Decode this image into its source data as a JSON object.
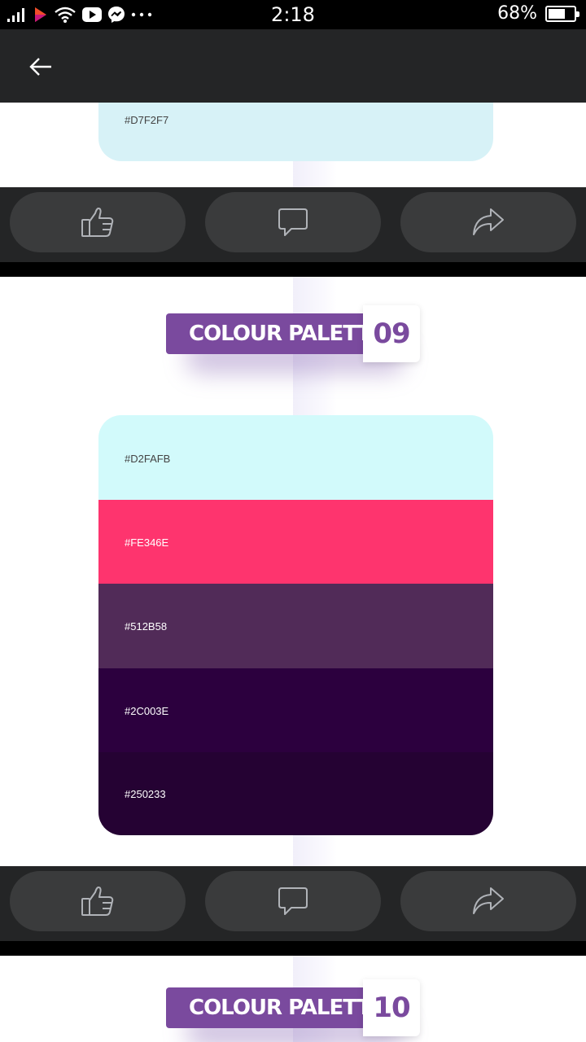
{
  "status_bar": {
    "time": "2:18",
    "battery_percent_text": "68%",
    "battery_level": 0.68,
    "icons": [
      "signal-icon",
      "app-notification-icon",
      "wifi-icon",
      "youtube-icon",
      "messenger-icon",
      "more-dots-icon"
    ]
  },
  "app_bar": {
    "back_icon": "arrow-left-icon"
  },
  "posts": [
    {
      "swatches": [
        {
          "code": "#D7F2F7",
          "color": "#D7F2F7",
          "text_color": "#444444"
        }
      ]
    },
    {
      "badge_label": "COLOUR PALETTE",
      "badge_number": "09",
      "swatches": [
        {
          "code": "#D2FAFB",
          "color": "#D2FAFB",
          "text_color": "#444444"
        },
        {
          "code": "#FE346E",
          "color": "#FE346E",
          "text_color": "#ffffff"
        },
        {
          "code": "#512B58",
          "color": "#512B58",
          "text_color": "#ffffff"
        },
        {
          "code": "#2C003E",
          "color": "#2C003E",
          "text_color": "#ffffff"
        },
        {
          "code": "#250233",
          "color": "#250233",
          "text_color": "#ffffff"
        }
      ]
    },
    {
      "badge_label": "COLOUR PALETTE",
      "badge_number": "10"
    }
  ],
  "actions": {
    "like_icon": "thumbs-up-icon",
    "comment_icon": "comment-icon",
    "share_icon": "share-icon"
  },
  "colors": {
    "bar_background": "#242526",
    "button_background": "#3a3b3c",
    "badge_purple": "#7a4a9e"
  }
}
